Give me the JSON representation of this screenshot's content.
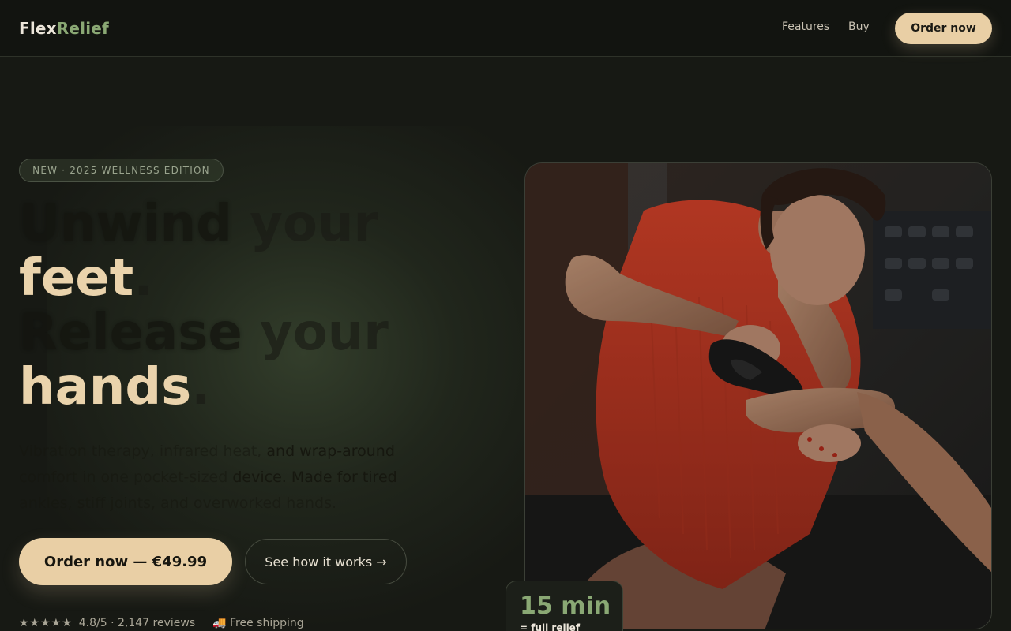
{
  "brand": {
    "part1": "Flex",
    "part2": "Relief"
  },
  "nav": {
    "features": "Features",
    "buy": "Buy",
    "cta": "Order now"
  },
  "hero": {
    "badge": "NEW · 2025 WELLNESS EDITION",
    "headline": {
      "line1_dim": "Unwind",
      "line1_rest": " your",
      "line2_lit": "feet",
      "line2_rest": ".",
      "line3_dim": "Release",
      "line3_rest": " your",
      "line4_lit": "hands",
      "line4_rest": "."
    },
    "lede": {
      "part1": "Vibration therapy, infrared heat,",
      "part2": " and wrap-around",
      "part3": "comfort in one pocket-sized",
      "part4": " device. Made for tired",
      "part5": "ankles, stiff joints, and overworked hands."
    },
    "primary_cta": "Order now — €49.99",
    "secondary_cta": "See how it works →",
    "rating": {
      "stars": "★★★★★",
      "text": "4.8/5 · 2,147 reviews"
    },
    "shipping": "🚚 Free shipping"
  },
  "stat": {
    "value": "15 min",
    "label": "= full relief"
  },
  "image": {
    "subject": "woman in red dress using massage device on foot",
    "icon": "photo"
  },
  "colors": {
    "background": "#171914",
    "accent_cream": "#e9cfa5",
    "accent_green": "#8aa874",
    "dress_red": "#c23a24"
  }
}
